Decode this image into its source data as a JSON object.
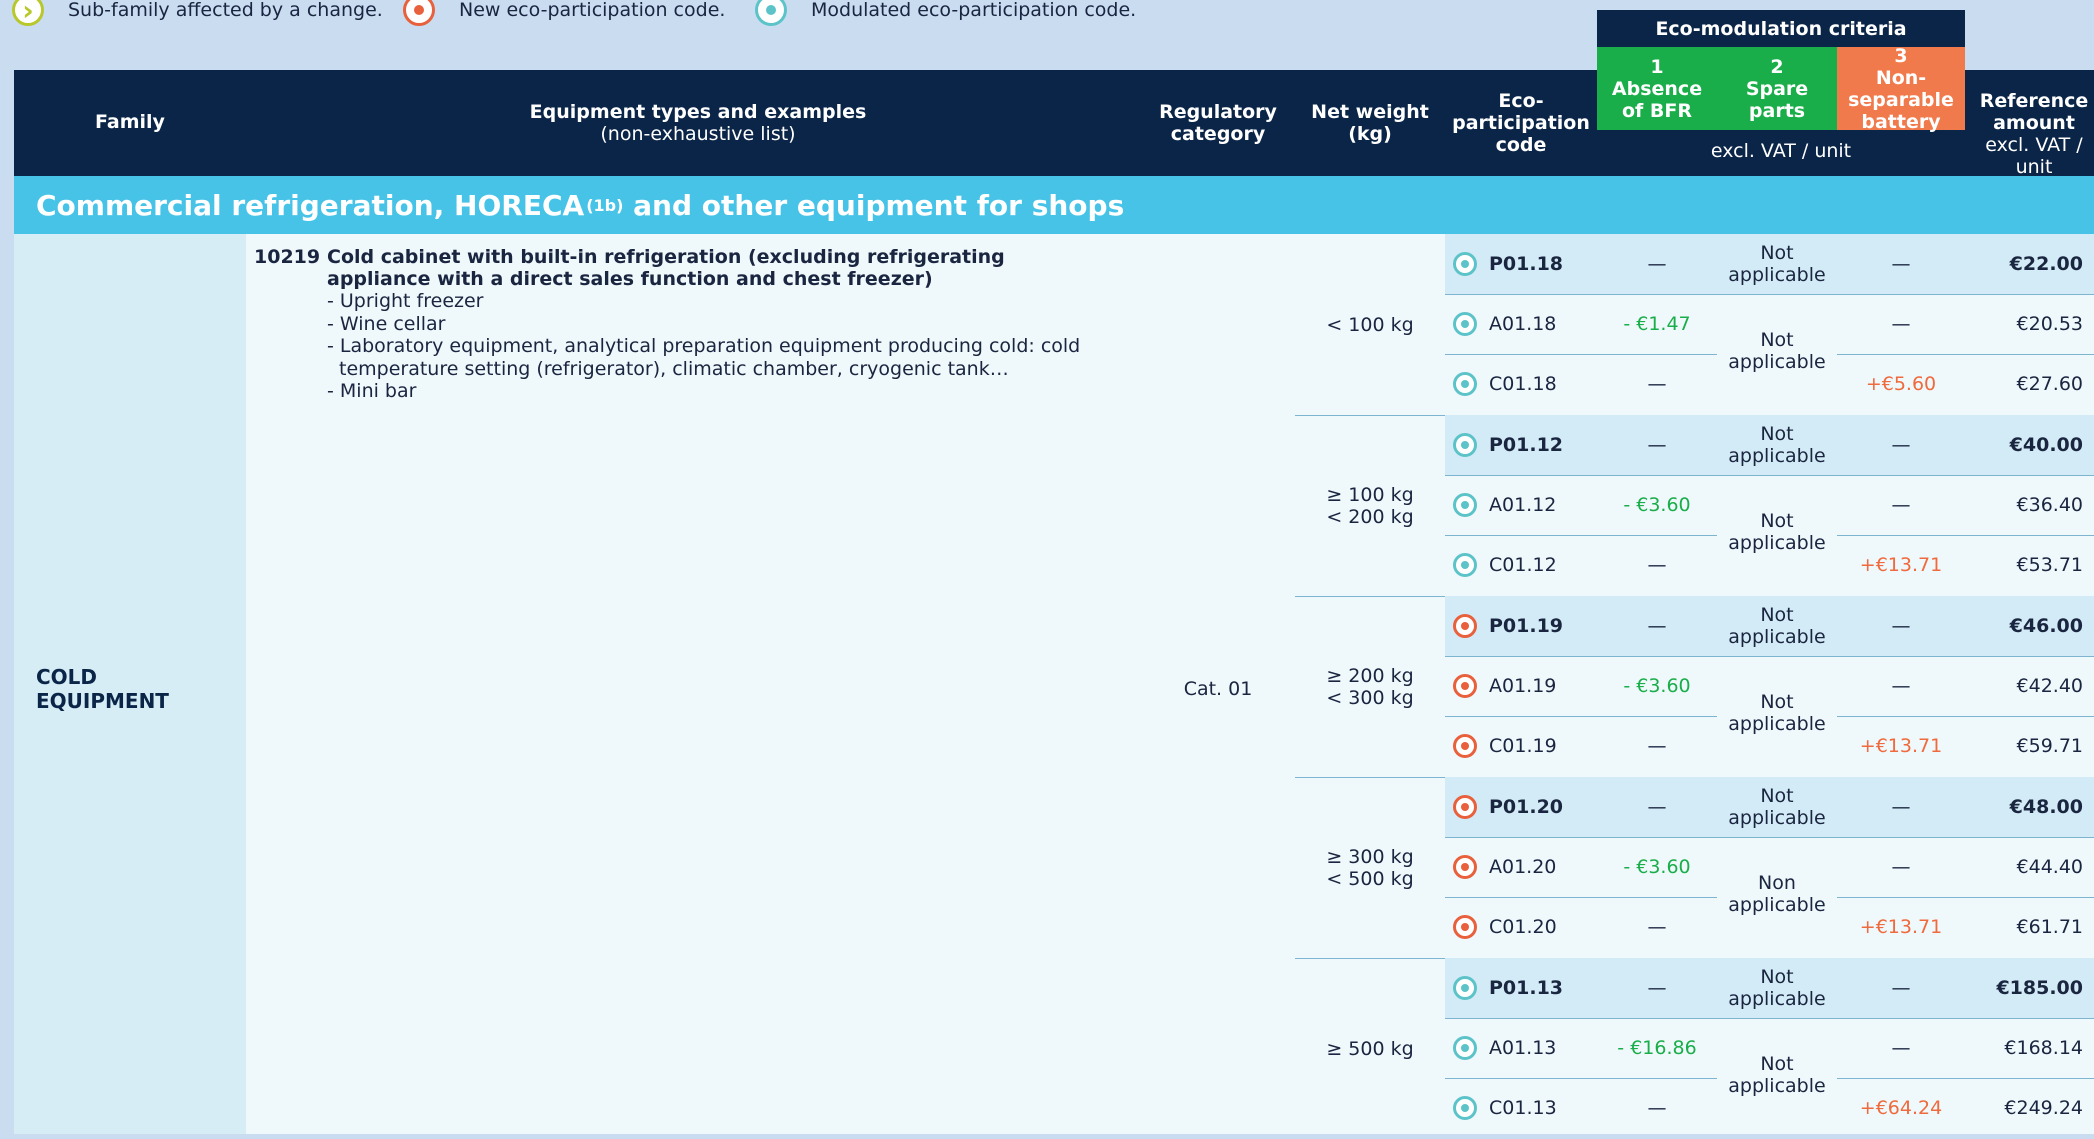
{
  "legend": {
    "items": [
      {
        "icon": "chevron-circle-icon",
        "label": "Sub-family affected by a change."
      },
      {
        "icon": "new-code-dot-icon",
        "label": "New eco-participation code."
      },
      {
        "icon": "modulated-code-dot-icon",
        "label": "Modulated eco-participation code."
      }
    ]
  },
  "header": {
    "family": "Family",
    "equipment": "Equipment types and examples",
    "equipment_sub": "(non-exhaustive list)",
    "regulatory": "Regulatory category",
    "net_weight": "Net weight (kg)",
    "eco_code": "Eco-participation code",
    "ecomod_title": "Eco-modulation criteria",
    "criteria": [
      {
        "num": "1",
        "label": "Absence of BFR"
      },
      {
        "num": "2",
        "label": "Spare parts"
      },
      {
        "num": "3",
        "label": "Non-separable battery"
      }
    ],
    "criteria_unit": "excl. VAT / unit",
    "reference": "Reference amount",
    "reference_unit": "excl. VAT / unit"
  },
  "colors": {
    "navy": "#0a2547",
    "green": "#1aae4a",
    "orange": "#f07a4c",
    "cyan": "#48c3e8"
  },
  "section": {
    "title": "Commercial refrigeration, HORECA",
    "sup": "(1b)",
    "title_end": " and other equipment for shops"
  },
  "family": {
    "label_line1": "COLD",
    "label_line2": "EQUIPMENT"
  },
  "equipment": {
    "code": "10219",
    "title": "Cold cabinet with built-in refrigeration (excluding refrigerating appliance with a direct sales function and chest freezer)",
    "examples": [
      "- Upright freezer",
      "- Wine cellar",
      "- Laboratory equipment, analytical preparation equipment producing cold: cold temperature setting (refrigerator), climatic chamber, cryogenic tank…",
      "- Mini bar"
    ]
  },
  "regulatory_category": "Cat. 01",
  "weight_groups": [
    {
      "label_line1": "< 100 kg",
      "label_line2": "",
      "na_label_line1": "Not",
      "na_label_line2": "applicable",
      "rows": [
        {
          "type": "modulated",
          "code": "P01.18",
          "bold": true,
          "c1": "—",
          "c2a": "Not",
          "c2b": "applicable",
          "c3": "—",
          "ref": "€22.00"
        },
        {
          "type": "modulated",
          "code": "A01.18",
          "bold": false,
          "c1": "- €1.47",
          "c3": "—",
          "ref": "€20.53"
        },
        {
          "type": "modulated",
          "code": "C01.18",
          "bold": false,
          "c1": "—",
          "c3": "+€5.60",
          "ref": "€27.60"
        }
      ]
    },
    {
      "label_line1": "≥ 100 kg",
      "label_line2": "< 200 kg",
      "na_label_line1": "Not",
      "na_label_line2": "applicable",
      "rows": [
        {
          "type": "modulated",
          "code": "P01.12",
          "bold": true,
          "c1": "—",
          "c2a": "Not",
          "c2b": "applicable",
          "c3": "—",
          "ref": "€40.00"
        },
        {
          "type": "modulated",
          "code": "A01.12",
          "bold": false,
          "c1": "- €3.60",
          "c3": "—",
          "ref": "€36.40"
        },
        {
          "type": "modulated",
          "code": "C01.12",
          "bold": false,
          "c1": "—",
          "c3": "+€13.71",
          "ref": "€53.71"
        }
      ]
    },
    {
      "label_line1": "≥ 200 kg",
      "label_line2": "< 300 kg",
      "na_label_line1": "Not",
      "na_label_line2": "applicable",
      "rows": [
        {
          "type": "new",
          "code": "P01.19",
          "bold": true,
          "c1": "—",
          "c2a": "Not",
          "c2b": "applicable",
          "c3": "—",
          "ref": "€46.00"
        },
        {
          "type": "new",
          "code": "A01.19",
          "bold": false,
          "c1": "- €3.60",
          "c3": "—",
          "ref": "€42.40"
        },
        {
          "type": "new",
          "code": "C01.19",
          "bold": false,
          "c1": "—",
          "c3": "+€13.71",
          "ref": "€59.71"
        }
      ]
    },
    {
      "label_line1": "≥ 300 kg",
      "label_line2": "< 500 kg",
      "na_label_line1": "Non",
      "na_label_line2": "applicable",
      "rows": [
        {
          "type": "new",
          "code": "P01.20",
          "bold": true,
          "c1": "—",
          "c2a": "Not",
          "c2b": "applicable",
          "c3": "—",
          "ref": "€48.00"
        },
        {
          "type": "new",
          "code": "A01.20",
          "bold": false,
          "c1": "- €3.60",
          "c3": "—",
          "ref": "€44.40"
        },
        {
          "type": "new",
          "code": "C01.20",
          "bold": false,
          "c1": "—",
          "c3": "+€13.71",
          "ref": "€61.71"
        }
      ]
    },
    {
      "label_line1": "≥ 500 kg",
      "label_line2": "",
      "na_label_line1": "Not",
      "na_label_line2": "applicable",
      "rows": [
        {
          "type": "modulated",
          "code": "P01.13",
          "bold": true,
          "c1": "—",
          "c2a": "Not",
          "c2b": "applicable",
          "c3": "—",
          "ref": "€185.00"
        },
        {
          "type": "modulated",
          "code": "A01.13",
          "bold": false,
          "c1": "- €16.86",
          "c3": "—",
          "ref": "€168.14"
        },
        {
          "type": "modulated",
          "code": "C01.13",
          "bold": false,
          "c1": "—",
          "c3": "+€64.24",
          "ref": "€249.24"
        }
      ]
    }
  ]
}
